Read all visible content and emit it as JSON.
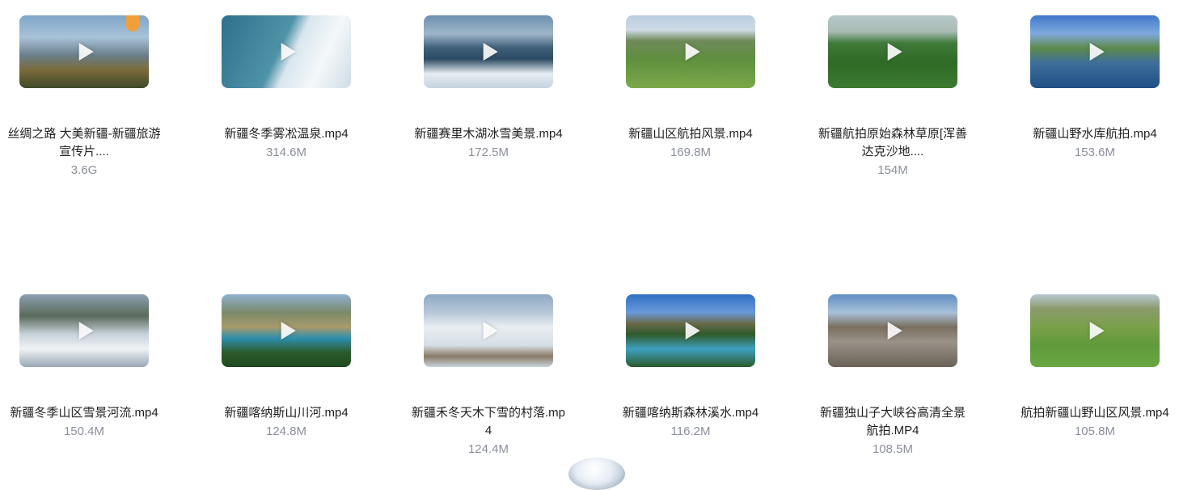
{
  "videos": [
    {
      "name": "丝绸之路 大美新疆-新疆旅游宣传片....",
      "size": "3.6G"
    },
    {
      "name": "新疆冬季雾凇温泉.mp4",
      "size": "314.6M"
    },
    {
      "name": "新疆赛里木湖冰雪美景.mp4",
      "size": "172.5M"
    },
    {
      "name": "新疆山区航拍风景.mp4",
      "size": "169.8M"
    },
    {
      "name": "新疆航拍原始森林草原[浑善达克沙地....",
      "size": "154M"
    },
    {
      "name": "新疆山野水库航拍.mp4",
      "size": "153.6M"
    },
    {
      "name": "新疆冬季山区雪景河流.mp4",
      "size": "150.4M"
    },
    {
      "name": "新疆喀纳斯山川河.mp4",
      "size": "124.8M"
    },
    {
      "name": "新疆禾冬天木下雪的村落.mp4",
      "size": "124.4M"
    },
    {
      "name": "新疆喀纳斯森林溪水.mp4",
      "size": "116.2M"
    },
    {
      "name": "新疆独山子大峡谷高清全景航拍.MP4",
      "size": "108.5M"
    },
    {
      "name": "航拍新疆山野山区风景.mp4",
      "size": "105.8M"
    }
  ]
}
